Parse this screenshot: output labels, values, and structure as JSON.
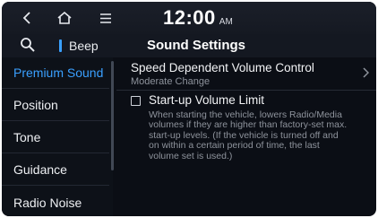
{
  "header": {
    "time": "12:00",
    "ampm": "AM",
    "back_icon": "back-chevron-icon",
    "home_icon": "home-icon",
    "menu_icon": "menu-icon"
  },
  "subheader": {
    "search_icon": "search-icon",
    "beep_label": "Beep",
    "page_title": "Sound Settings"
  },
  "sidebar": {
    "items": [
      {
        "label": "Premium Sound",
        "active": true
      },
      {
        "label": "Position",
        "active": false
      },
      {
        "label": "Tone",
        "active": false
      },
      {
        "label": "Guidance",
        "active": false
      },
      {
        "label": "Radio Noise",
        "active": false
      }
    ]
  },
  "content": {
    "speed_volume": {
      "title": "Speed Dependent Volume Control",
      "value": "Moderate Change"
    },
    "startup_limit": {
      "title": "Start-up Volume Limit",
      "checked": false,
      "description": "When starting the vehicle, lowers Radio/Media\nvolumes if they are higher than factory-set max.\nstart-up levels. (If the vehicle is turned off and\non within a certain period of time, the last\nvolume set is used.)"
    }
  },
  "colors": {
    "accent": "#3aa0ff",
    "background": "#0b0e15",
    "text_primary": "#f2f3f5",
    "text_secondary": "#8e939c"
  }
}
